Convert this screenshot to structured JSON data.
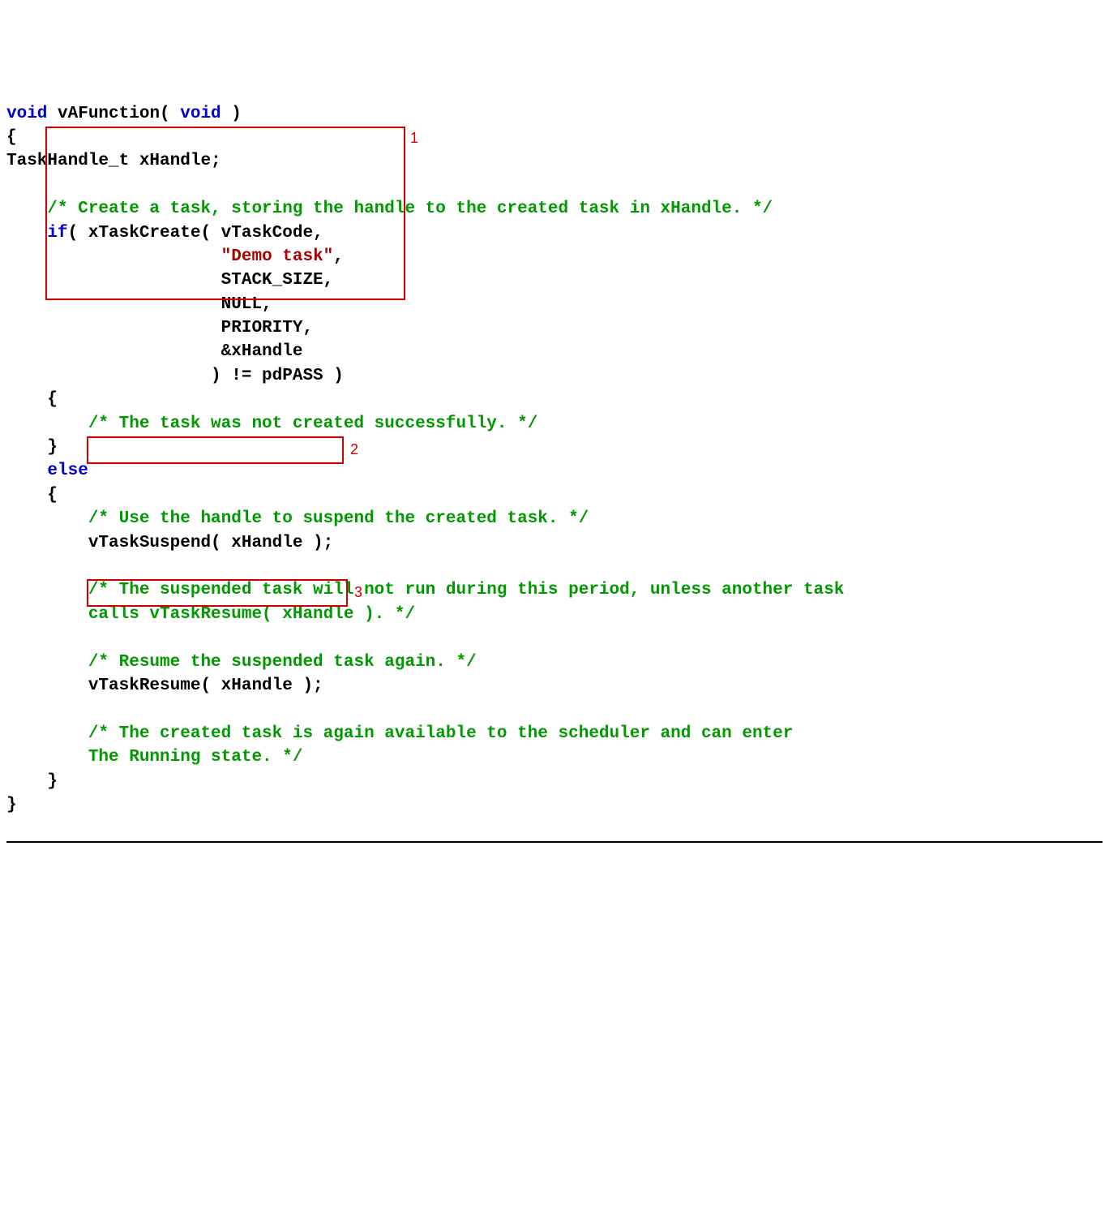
{
  "code": {
    "l01a": "void",
    "l01b": " vAFunction( ",
    "l01c": "void",
    "l01d": " )",
    "l02": "{",
    "l03": "TaskHandle_t xHandle;",
    "l04": "",
    "l05": "    /* Create a task, storing the handle to the created task in xHandle. */",
    "l06a": "    ",
    "l06b": "if",
    "l06c": "( xTaskCreate( vTaskCode,",
    "l07a": "                     ",
    "l07b": "\"Demo task\"",
    "l07c": ",",
    "l08": "                     STACK_SIZE,",
    "l09": "                     NULL,",
    "l10": "                     PRIORITY,",
    "l11": "                     &xHandle",
    "l12": "                    ) != pdPASS )",
    "l13": "    {",
    "l14": "        /* The task was not created successfully. */",
    "l15": "    }",
    "l16a": "    ",
    "l16b": "else",
    "l17": "    {",
    "l18": "        /* Use the handle to suspend the created task. */",
    "l19": "        vTaskSuspend( xHandle );",
    "l20": "",
    "l21": "        /* The suspended task will not run during this period, unless another task",
    "l22": "        calls vTaskResume( xHandle ). */",
    "l23": "",
    "l24": "        /* Resume the suspended task again. */",
    "l25": "        vTaskResume( xHandle );",
    "l26": "",
    "l27": "        /* The created task is again available to the scheduler and can enter",
    "l28": "        The Running state. */",
    "l29": "    }",
    "l30": "}"
  },
  "annotations": {
    "box1_label": "1",
    "box2_label": "2",
    "box3_label": "3"
  },
  "colors": {
    "keyword": "#0000cc",
    "comment": "#009900",
    "string": "#aa0000",
    "default": "#000000",
    "box": "#d00000"
  }
}
